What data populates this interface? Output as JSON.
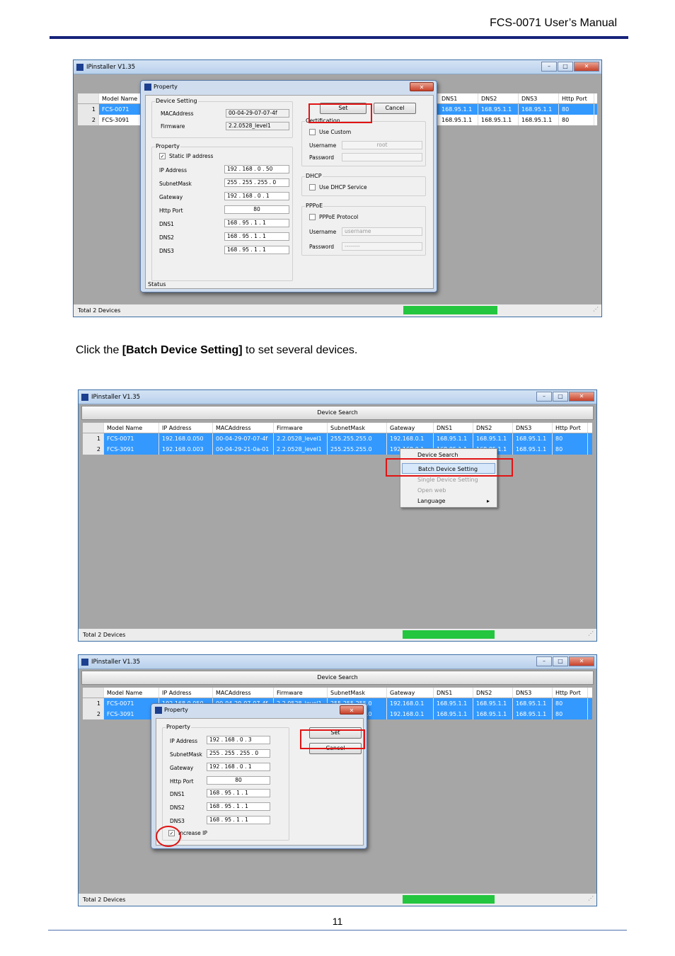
{
  "header": {
    "title": "FCS-0071 User’s Manual"
  },
  "intro": {
    "prefix": "Click the ",
    "bold": "[Batch Device Setting]",
    "suffix": " to set several devices."
  },
  "footer": {
    "page_number": "11"
  },
  "app": {
    "title": "IPinstaller V1.35",
    "search_button": "Device Search",
    "status": "Total 2 Devices",
    "columns": [
      "Model Name",
      "IP Address",
      "MACAddress",
      "Firmware",
      "SubnetMask",
      "Gateway",
      "DNS1",
      "DNS2",
      "DNS3",
      "Http Port"
    ],
    "rows": [
      {
        "num": "1",
        "model": "FCS-0071",
        "ip": "192.168.0.050",
        "mac": "00-04-29-07-07-4f",
        "fw": "2.2.0528_level1",
        "mask": "255.255.255.0",
        "gw": "192.168.0.1",
        "dns1": "168.95.1.1",
        "dns2": "168.95.1.1",
        "dns3": "168.95.1.1",
        "port": "80"
      },
      {
        "num": "2",
        "model": "FCS-3091",
        "ip": "192.168.0.003",
        "mac": "00-04-29-21-0a-01",
        "fw": "2.2.0528_level1",
        "mask": "255.255.255.0",
        "gw": "192.168.0.1",
        "dns1": "168.95.1.1",
        "dns2": "168.95.1.1",
        "dns3": "168.95.1.1",
        "port": "80"
      }
    ]
  },
  "shot1": {
    "dialog_title": "Property",
    "device_setting": {
      "title": "Device Setting",
      "mac_label": "MACAddress",
      "mac_value": "00-04-29-07-07-4f",
      "fw_label": "Firmware",
      "fw_value": "2.2.0528_level1"
    },
    "property": {
      "title": "Property",
      "static_ip": "Static IP address",
      "ip_label": "IP Address",
      "ip": "192 . 168 .   0  .  50",
      "mask_label": "SubnetMask",
      "mask": "255 . 255 . 255 .   0",
      "gw_label": "Gateway",
      "gw": "192 . 168 .   0  .   1",
      "port_label": "Http Port",
      "port": "80",
      "dns1_label": "DNS1",
      "dns1": "168 .  95  .   1  .   1",
      "dns2_label": "DNS2",
      "dns2": "168 .  95  .   1  .   1",
      "dns3_label": "DNS3",
      "dns3": "168 .  95  .   1  .   1"
    },
    "set": "Set",
    "cancel": "Cancel",
    "cert": {
      "title": "Certification",
      "use_custom": "Use Custom",
      "user_label": "Username",
      "user_value": "root",
      "pass_label": "Password"
    },
    "dhcp": {
      "title": "DHCP",
      "use": "Use DHCP Service"
    },
    "pppoe": {
      "title": "PPPoE",
      "protocol": "PPPoE Protocol",
      "user_label": "Username",
      "user_value": "username",
      "pass_label": "Password",
      "pass_value": "--------"
    },
    "status": "Status"
  },
  "shot2": {
    "menu": [
      "Device Search",
      "Batch Device Setting",
      "Single Device Setting",
      "Open web",
      "Language"
    ]
  },
  "shot3": {
    "dialog_title": "Property",
    "group": "Property",
    "ip_label": "IP Address",
    "ip": "192 . 168 .   0  .   3",
    "mask_label": "SubnetMask",
    "mask": "255 . 255 . 255 .   0",
    "gw_label": "Gateway",
    "gw": "192 . 168 .   0  .   1",
    "port_label": "Http Port",
    "port": "80",
    "dns1_label": "DNS1",
    "dns1": "168 .  95  .   1  .   1",
    "dns2_label": "DNS2",
    "dns2": "168 .  95  .   1  .   1",
    "dns3_label": "DNS3",
    "dns3": "168 .  95  .   1  .   1",
    "increase": "Increase IP",
    "set": "Set",
    "cancel": "Cancel"
  }
}
